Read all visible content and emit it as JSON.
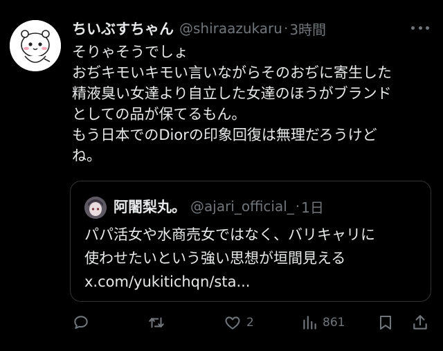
{
  "tweet": {
    "display_name": "ちいぶすちゃん",
    "handle": "@shiraazukaru",
    "separator": "·",
    "time": "3時間",
    "lines": [
      "そりゃそうでしょ",
      "おぢキモいキモい言いながらそのおぢに寄生した",
      "精液臭い女達より自立した女達のほうがブランド",
      "としての品が保てるもん。",
      "もう日本でのDiorの印象回復は無理だろうけど",
      "ね。"
    ]
  },
  "quote": {
    "display_name": "阿闍梨丸。",
    "handle": "@ajari_official_",
    "separator": "·",
    "time": "1日",
    "lines": [
      "パパ活女や水商売女ではなく、バリキャリに",
      "使わせたいという強い思想が垣間見える",
      "x.com/yukitichqn/sta..."
    ]
  },
  "actions": {
    "reply_count": "",
    "repost_count": "",
    "like_count": "2",
    "views_count": "861"
  },
  "icons": {
    "avatar": "chiikawa-character-avatar",
    "quote_avatar": "anime-character-avatar",
    "more": "more-horizontal-icon",
    "reply": "reply-icon",
    "repost": "repost-icon",
    "like": "heart-icon",
    "views": "views-bar-chart-icon",
    "bookmark": "bookmark-icon",
    "share": "share-icon"
  },
  "colors": {
    "background": "#000000",
    "text": "#e7e9ea",
    "secondary": "#71767b",
    "border": "#2f3336"
  }
}
